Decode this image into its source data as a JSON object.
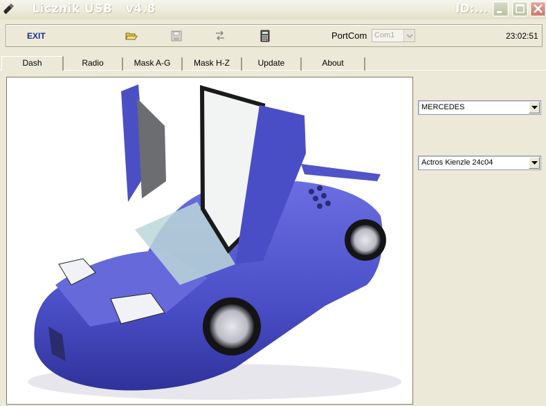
{
  "window": {
    "title": "Licznik USB   v4.8",
    "id_label": "ID:...",
    "controls": [
      "minimize",
      "maximize",
      "close"
    ]
  },
  "toolbar": {
    "exit_label": "EXIT",
    "icons": [
      "open-folder-icon",
      "save-icon",
      "swap-icon",
      "calculator-icon"
    ],
    "portcom_label": "PortCom",
    "portcom_value": "Com1",
    "clock": "23:02:51"
  },
  "tabs": [
    {
      "label": "Dash",
      "active": true
    },
    {
      "label": "Radio",
      "active": false
    },
    {
      "label": "Mask  A-G",
      "active": false
    },
    {
      "label": "Mask  H-Z",
      "active": false
    },
    {
      "label": "Update",
      "active": false
    },
    {
      "label": "About",
      "active": false
    }
  ],
  "dash": {
    "picture": "blue sports car with open scissor doors",
    "brand_select": "MERCEDES",
    "model_select": "Actros Kienzle 24c04"
  },
  "colors": {
    "window_bg": "#ece9d8",
    "car_blue": "#4b4fc4",
    "exit_text": "#1b2f8c"
  }
}
